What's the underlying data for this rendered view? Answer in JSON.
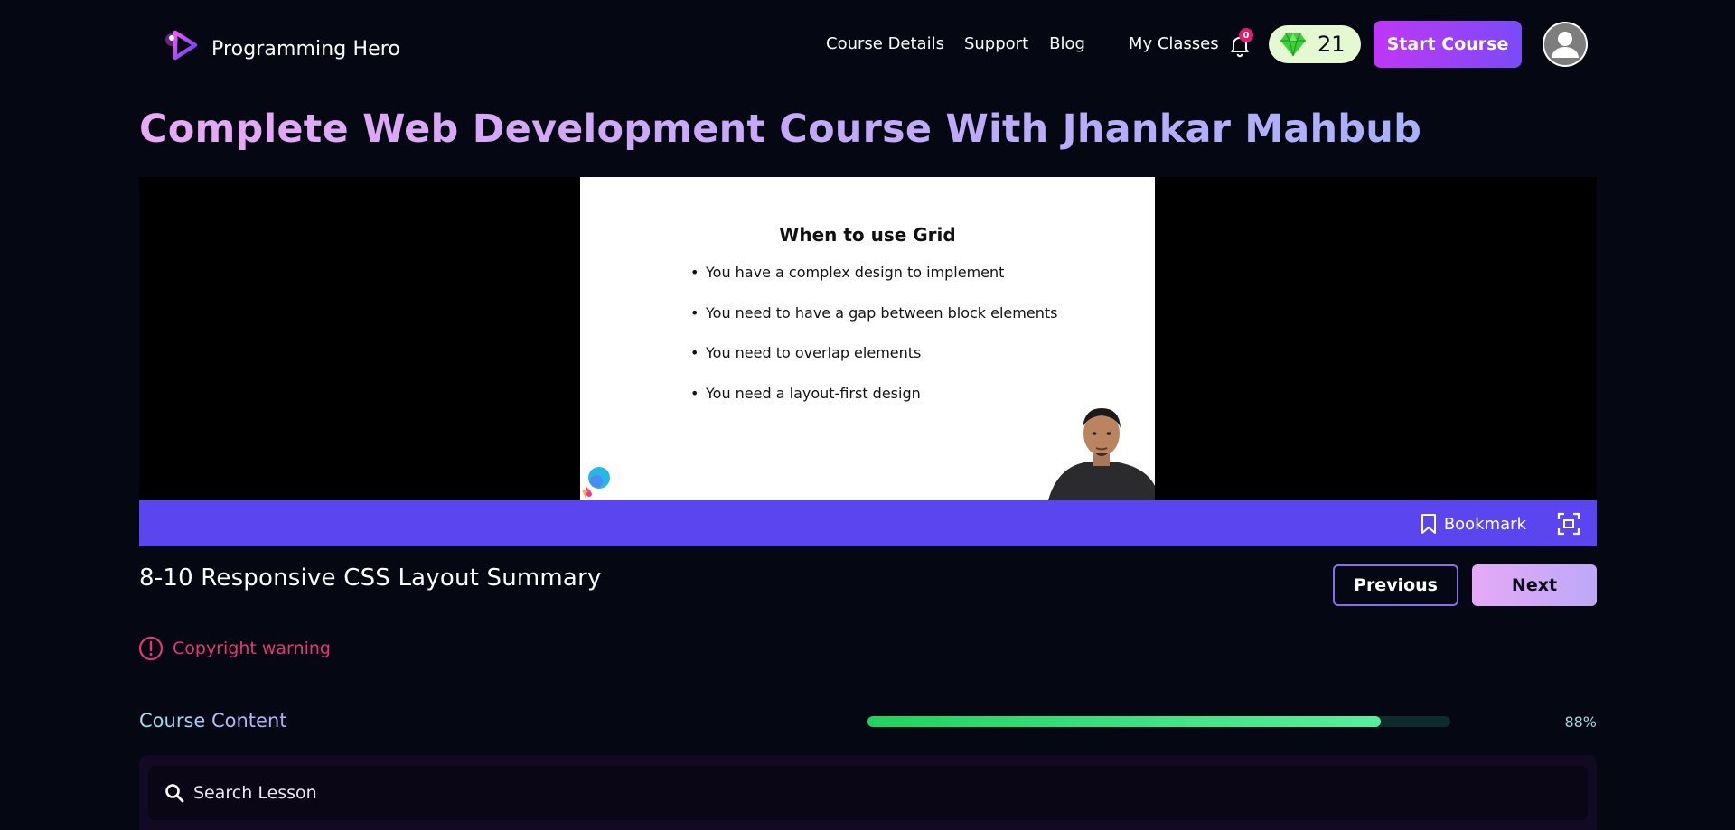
{
  "brand": {
    "name": "Programming Hero"
  },
  "nav": {
    "items": [
      {
        "label": "Course Details"
      },
      {
        "label": "Support"
      },
      {
        "label": "Blog"
      },
      {
        "label": "My Classes"
      }
    ],
    "notification_count": "0",
    "gems_count": "21",
    "start_course_label": "Start Course"
  },
  "course": {
    "title": "Complete Web Development Course With Jhankar Mahbub"
  },
  "video": {
    "slide_title": "When to use Grid",
    "slide_points": [
      "You have a complex design to implement",
      "You need to have a gap between block elements",
      "You need to overlap elements",
      "You need a layout-first design"
    ],
    "bookmark_label": "Bookmark"
  },
  "lesson": {
    "title": "8-10 Responsive CSS Layout Summary",
    "previous_label": "Previous",
    "next_label": "Next"
  },
  "copyright_warning": "Copyright warning",
  "course_content": {
    "label": "Course Content",
    "progress_percent": 88,
    "progress_text": "88%",
    "search_placeholder": "Search Lesson"
  },
  "colors": {
    "background": "#050713",
    "accent": "#5b45ee",
    "start_button": "#c037f6",
    "warning": "#e23a70",
    "progress": "#1fd35f"
  }
}
